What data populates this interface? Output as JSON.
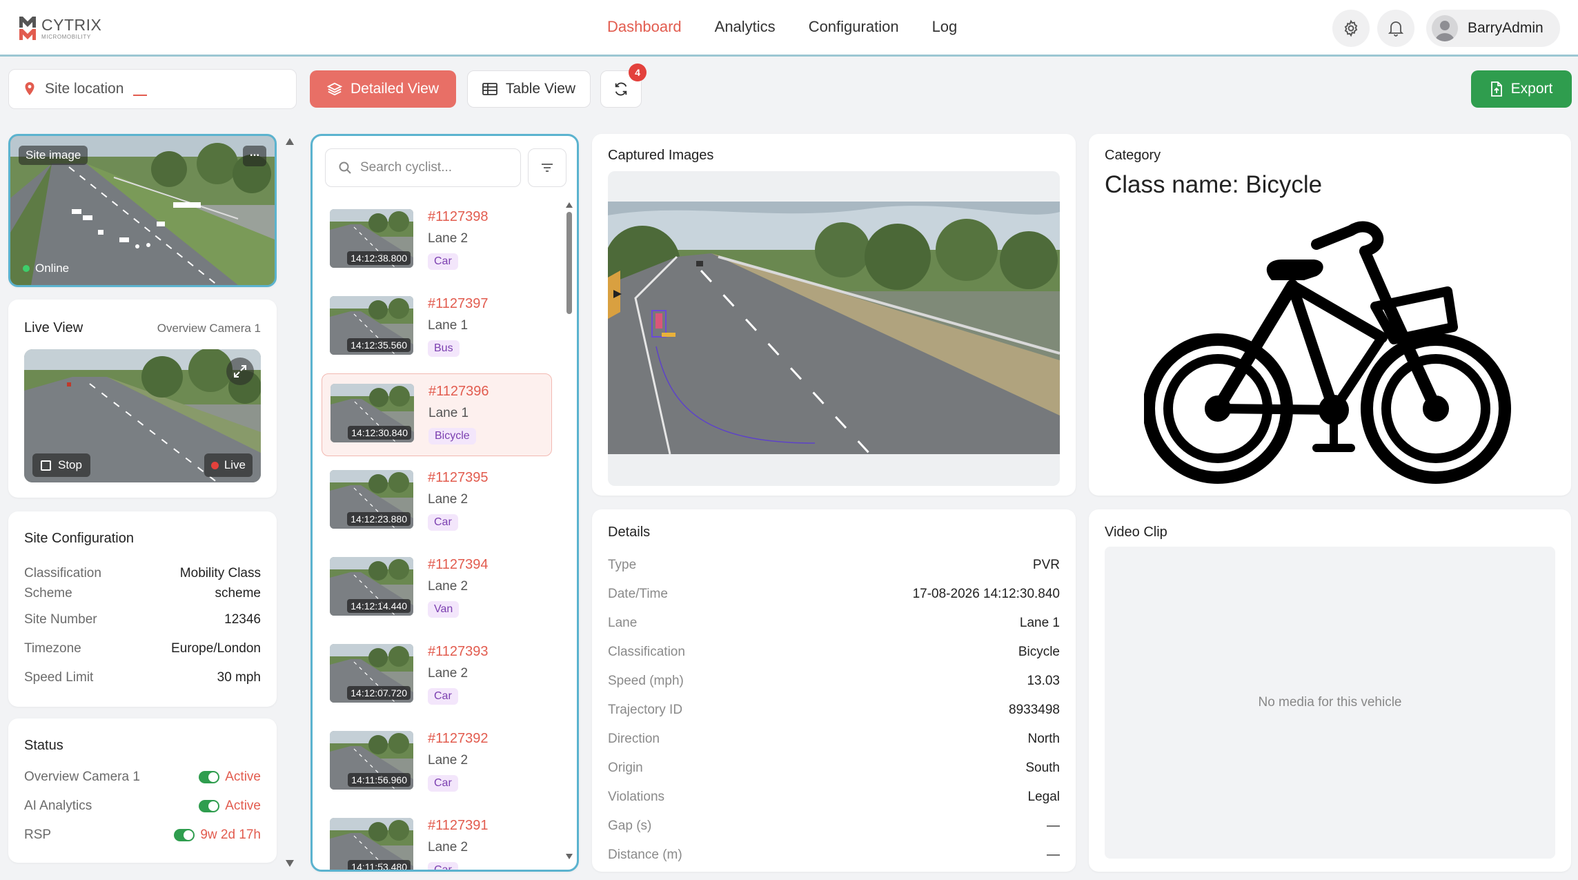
{
  "brand": {
    "name": "CYTRIX",
    "sub": "MICROMOBILITY",
    "accent": "#e25c4f"
  },
  "nav": {
    "items": [
      {
        "label": "Dashboard",
        "active": true
      },
      {
        "label": "Analytics",
        "active": false
      },
      {
        "label": "Configuration",
        "active": false
      },
      {
        "label": "Log",
        "active": false
      }
    ],
    "user": "BarryAdmin"
  },
  "toolbar": {
    "site_location_label": "Site location",
    "site_location_value": "—",
    "detailed_view": "Detailed View",
    "table_view": "Table View",
    "refresh_badge": "4",
    "export": "Export"
  },
  "site_image": {
    "title": "Site image",
    "status": "Online",
    "menu": "..."
  },
  "live_view": {
    "title": "Live View",
    "camera": "Overview Camera 1",
    "stop": "Stop",
    "live": "Live"
  },
  "site_config": {
    "title": "Site Configuration",
    "rows": [
      {
        "key": "Classification Scheme",
        "key_l1": "Classification",
        "key_l2": "Scheme",
        "value_l1": "Mobility Class",
        "value_l2": "scheme"
      },
      {
        "key": "Site Number",
        "value": "12346"
      },
      {
        "key": "Timezone",
        "value": "Europe/London"
      },
      {
        "key": "Speed Limit",
        "value": "30 mph"
      }
    ]
  },
  "status": {
    "title": "Status",
    "rows": [
      {
        "key": "Overview Camera 1",
        "value": "Active"
      },
      {
        "key": "AI Analytics",
        "value": "Active"
      },
      {
        "key": "RSP",
        "value": "9w 2d 17h"
      }
    ]
  },
  "list": {
    "search_placeholder": "Search cyclist...",
    "items": [
      {
        "id": "#1127398",
        "lane": "Lane 2",
        "type": "Car",
        "time": "14:12:38.800",
        "selected": false
      },
      {
        "id": "#1127397",
        "lane": "Lane 1",
        "type": "Bus",
        "time": "14:12:35.560",
        "selected": false
      },
      {
        "id": "#1127396",
        "lane": "Lane 1",
        "type": "Bicycle",
        "time": "14:12:30.840",
        "selected": true
      },
      {
        "id": "#1127395",
        "lane": "Lane 2",
        "type": "Car",
        "time": "14:12:23.880",
        "selected": false
      },
      {
        "id": "#1127394",
        "lane": "Lane 2",
        "type": "Van",
        "time": "14:12:14.440",
        "selected": false
      },
      {
        "id": "#1127393",
        "lane": "Lane 2",
        "type": "Car",
        "time": "14:12:07.720",
        "selected": false
      },
      {
        "id": "#1127392",
        "lane": "Lane 2",
        "type": "Car",
        "time": "14:11:56.960",
        "selected": false
      },
      {
        "id": "#1127391",
        "lane": "Lane 2",
        "type": "Car",
        "time": "14:11:53.480",
        "selected": false
      }
    ]
  },
  "captured": {
    "title": "Captured Images"
  },
  "details": {
    "title": "Details",
    "rows": [
      {
        "key": "Type",
        "value": "PVR"
      },
      {
        "key": "Date/Time",
        "value": "17-08-2026 14:12:30.840"
      },
      {
        "key": "Lane",
        "value": "Lane 1"
      },
      {
        "key": "Classification",
        "value": "Bicycle"
      },
      {
        "key": "Speed (mph)",
        "value": "13.03"
      },
      {
        "key": "Trajectory ID",
        "value": "8933498"
      },
      {
        "key": "Direction",
        "value": "North"
      },
      {
        "key": "Origin",
        "value": "South"
      },
      {
        "key": "Violations",
        "value": "Legal"
      },
      {
        "key": "Gap (s)",
        "value": "—"
      },
      {
        "key": "Distance (m)",
        "value": "—"
      }
    ]
  },
  "category": {
    "title": "Category",
    "class_name": "Class name: Bicycle"
  },
  "video": {
    "title": "Video Clip",
    "empty": "No media for this vehicle"
  }
}
